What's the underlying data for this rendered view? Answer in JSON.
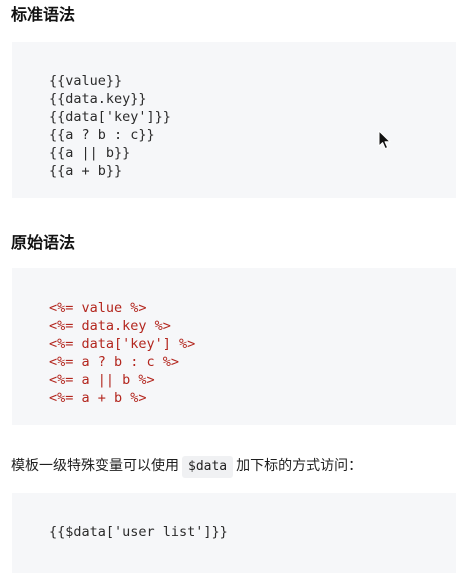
{
  "sections": {
    "standard": {
      "title": "标准语法",
      "lines": [
        "{{value}}",
        "{{data.key}}",
        "{{data['key']}}",
        "{{a ? b : c}}",
        "{{a || b}}",
        "{{a + b}}"
      ]
    },
    "raw": {
      "title": "原始语法",
      "lines": [
        "<%= value %>",
        "<%= data.key %>",
        "<%= data['key'] %>",
        "<%= a ? b : c %>",
        "<%= a || b %>",
        "<%= a + b %>"
      ]
    }
  },
  "paragraph": {
    "before": "模板一级特殊变量可以使用",
    "code": "$data",
    "after": "加下标的方式访问："
  },
  "example": {
    "line": "{{$data['user list']}}"
  },
  "colors": {
    "code_background": "#f6f7f9",
    "template_text": "#b3261e",
    "plain_code_text": "#2b2b2b"
  },
  "icons": {
    "cursor": "mouse-pointer-icon"
  }
}
